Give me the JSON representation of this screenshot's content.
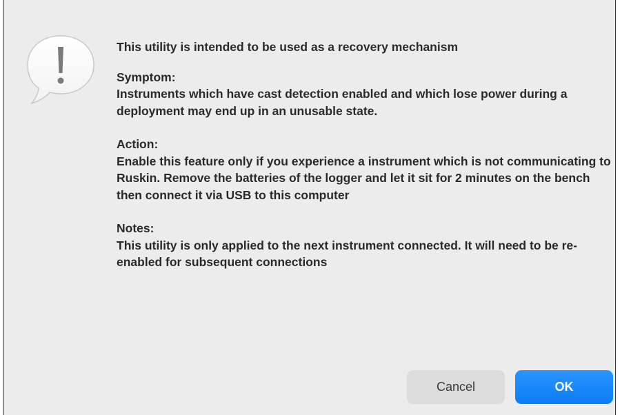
{
  "dialog": {
    "icon": "alert-exclamation-icon",
    "message": "This utility is intended to be used as a recovery mechanism",
    "sections": [
      {
        "heading": "Symptom:",
        "body": "Instruments which have cast detection enabled and which lose power during a deployment may end up in an unusable state."
      },
      {
        "heading": "Action:",
        "body": "Enable this feature only if you experience a instrument which is not communicating to Ruskin. Remove the batteries of the logger and let it sit for 2 minutes on the bench then connect it via USB to this computer"
      },
      {
        "heading": "Notes:",
        "body": "This utility is only applied to the next instrument connected. It will need to be re-enabled for subsequent connections"
      }
    ],
    "buttons": {
      "cancel_label": "Cancel",
      "ok_label": "OK"
    }
  },
  "colors": {
    "background": "#ececec",
    "accent": "#0a7cf5",
    "cancel_button": "#dcdcdc"
  }
}
